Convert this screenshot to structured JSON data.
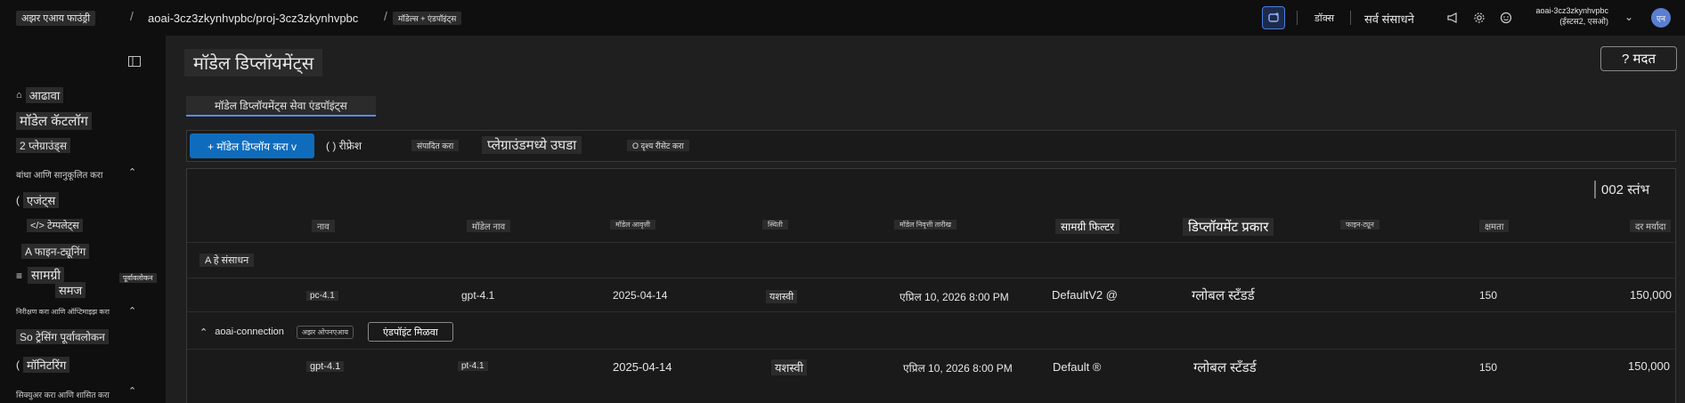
{
  "topbar": {
    "brand": "अझर एआय फाउंड्री",
    "project_path": "aoai-3cz3zkynhvpbc/proj-3cz3zkynhvpbc",
    "section": "मॉडेल्स + एंडपॉइंट्स",
    "docs": "डॉक्स",
    "all_resources": "सर्व संसाधने",
    "account_name": "aoai-3cz3zkynhvpbc",
    "account_region": "(ईस्टस2, एसओ)",
    "avatar_initials": "एन"
  },
  "sidebar": {
    "items": [
      {
        "label": "आढावा"
      },
      {
        "label": "मॉडेल कॅटलॉग"
      },
      {
        "label": "2 प्लेग्राउंड्स"
      },
      {
        "label": "बांधा आणि सानुकूलित करा"
      },
      {
        "label": "एजंट्स"
      },
      {
        "label": "</> टेम्पलेट्स"
      },
      {
        "label": "A फाइन-ट्यूनिंग"
      },
      {
        "label": "सामग्री"
      },
      {
        "label": "समज"
      },
      {
        "label": "पूर्वावलोकन"
      },
      {
        "label": "निरीक्षण करा आणि ऑप्टिमाइझ करा"
      },
      {
        "label": "So ट्रेसिंग पूर्वावलोकन"
      },
      {
        "label": "मॉनिटरिंग"
      },
      {
        "label": "सिक्युअर करा आणि शासित करा"
      }
    ]
  },
  "page": {
    "title": "मॉडेल डिप्लॉयमेंट्स",
    "help": "? मदत",
    "tab": "मॉडेल डिप्लॉयमेंट्स सेवा एंडपॉइंट्स"
  },
  "toolbar": {
    "deploy": "+ मॉडेल डिप्लॉय करा v",
    "refresh": "( ) रीफ्रेश",
    "edit": "संपादित करा",
    "open_playground": "प्लेग्राउंडमध्ये उघडा",
    "reset_view": "O दृश्य रीसेट करा"
  },
  "table": {
    "columns_label": "002 स्तंभ",
    "headers": [
      "नाव",
      "मॉडेल नाव",
      "मॉडेल आवृत्ती",
      "स्थिती",
      "मॉडेल निवृत्ती तारीख",
      "सामग्री फिल्टर",
      "डिप्लॉयमेंट प्रकार",
      "फाइन-ट्यून",
      "क्षमता",
      "दर मर्यादा"
    ],
    "group_label": "A हे संसाधन",
    "rows": [
      {
        "name": "pc-4.1",
        "model": "gpt-4.1",
        "version": "2025-04-14",
        "status": "यशस्वी",
        "retire": "एप्रिल 10, 2026 8:00 PM",
        "filter": "DefaultV2 @",
        "type": "ग्लोबल स्टँडर्ड",
        "capacity": "150",
        "rate": "150,000"
      },
      {
        "name": "gpt-4.1",
        "model": "pt-4.1",
        "version": "2025-04-14",
        "status": "यशस्वी",
        "retire": "एप्रिल 10, 2026 8:00 PM",
        "filter": "Default ®",
        "type": "ग्लोबल स्टँडर्ड",
        "capacity": "150",
        "rate": "150,000"
      }
    ],
    "connection": {
      "name": "aoai-connection",
      "badge": "अझर ओपनएआय",
      "endpoint_button": "एंडपॉइंट मिळवा"
    }
  }
}
